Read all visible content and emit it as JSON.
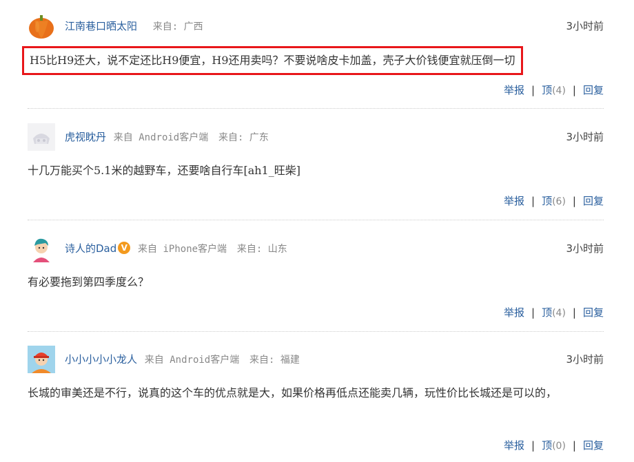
{
  "comments": [
    {
      "username": "江南巷口晒太阳",
      "client": "",
      "from_label": "来自: 广西",
      "time": "3小时前",
      "content": "H5比H9还大，说不定还比H9便宜，H9还用卖吗？不要说啥皮卡加盖，壳子大价钱便宜就压倒一切",
      "report_label": "举报",
      "up_label": "顶",
      "up_count": "(4)",
      "reply_label": "回复",
      "avatar": "pumpkin-avatar"
    },
    {
      "username": "虎视眈丹",
      "client": "来自 Android客户端",
      "from_label": "来自: 广东",
      "time": "3小时前",
      "content": "十几万能买个5.1米的越野车，还要啥自行车[ah1_旺柴]",
      "report_label": "举报",
      "up_label": "顶",
      "up_count": "(6)",
      "reply_label": "回复",
      "avatar": "default-avatar"
    },
    {
      "username": "诗人的Dad",
      "badge": "V",
      "client": "来自 iPhone客户端",
      "from_label": "来自: 山东",
      "time": "3小时前",
      "content": "有必要拖到第四季度么？",
      "report_label": "举报",
      "up_label": "顶",
      "up_count": "(4)",
      "reply_label": "回复",
      "avatar": "cartoon-boy-avatar"
    },
    {
      "username": "小小小小小龙人",
      "client": "来自 Android客户端",
      "from_label": "来自: 福建",
      "time": "3小时前",
      "content": "长城的审美还是不行，说真的这个车的优点就是大，如果价格再低点还能卖几辆，玩性价比长城还是可以的，",
      "report_label": "举报",
      "up_label": "顶",
      "up_count": "(0)",
      "reply_label": "回复",
      "avatar": "cartoon-man-cap-avatar"
    }
  ],
  "colors": {
    "username": "#2a5f9e",
    "highlight_border": "#e8161a",
    "badge": "#f39a1e"
  }
}
